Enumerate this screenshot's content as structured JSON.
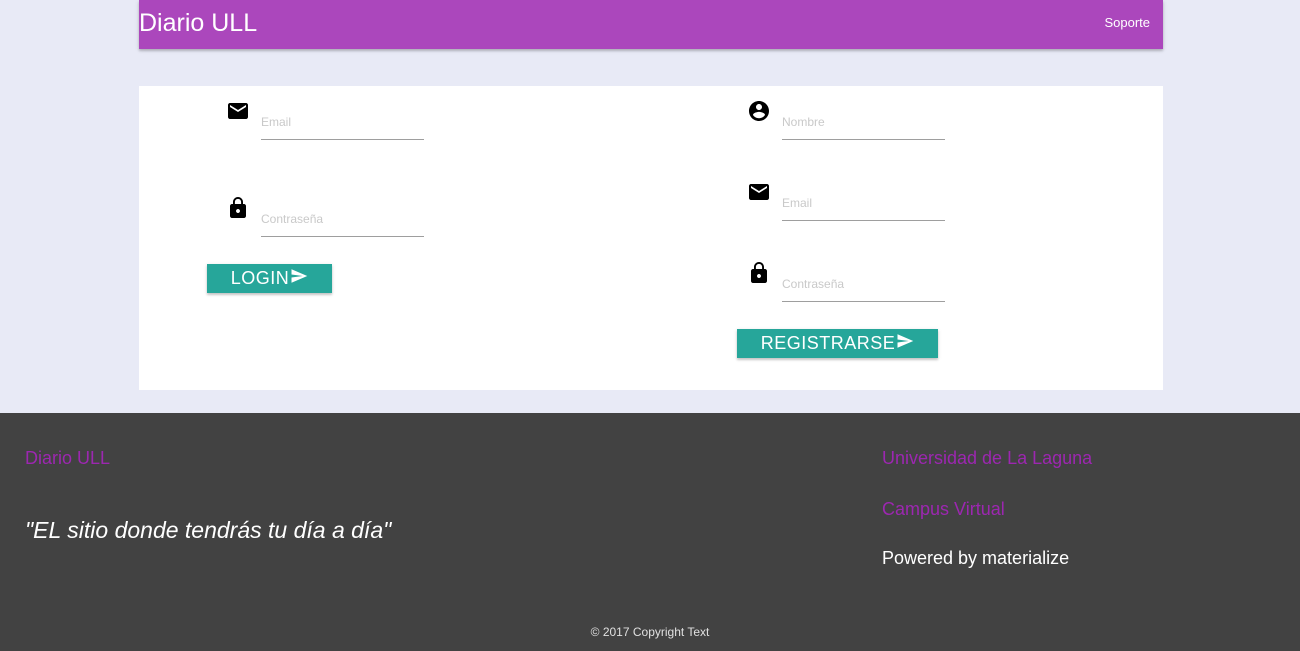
{
  "navbar": {
    "brand": "Diario ULL",
    "support_link": "Soporte"
  },
  "login": {
    "email_placeholder": "Email",
    "password_placeholder": "Contraseña",
    "button_label": "LOGIN"
  },
  "register": {
    "name_placeholder": "Nombre",
    "email_placeholder": "Email",
    "password_placeholder": "Contraseña",
    "button_label": "REGISTRARSE"
  },
  "footer": {
    "title": "Diario ULL",
    "quote": "\"EL sitio donde tendrás tu día a día\"",
    "links": [
      "Universidad de La Laguna",
      "Campus Virtual"
    ],
    "powered": "Powered by materialize",
    "copyright": "© 2017 Copyright Text"
  },
  "colors": {
    "navbar": "#ab47bc",
    "background": "#e8eaf6",
    "button": "#26a69a",
    "footer": "#424242",
    "footer_link": "#9c27b0"
  },
  "icons": [
    "mail-icon",
    "lock-icon",
    "account-circle-icon",
    "send-icon"
  ]
}
